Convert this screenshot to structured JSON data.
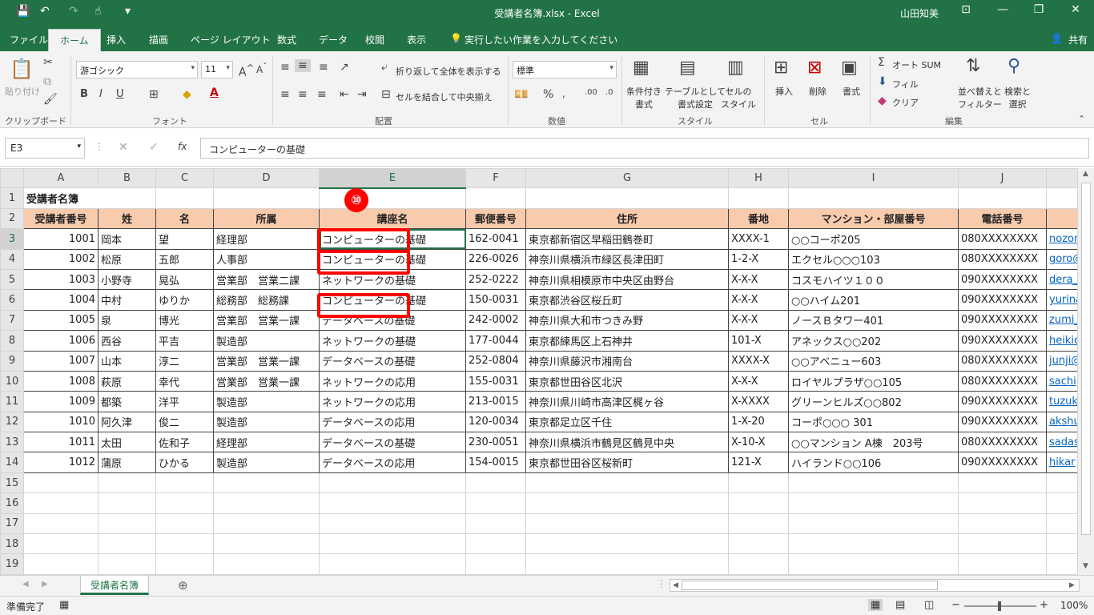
{
  "window": {
    "title": "受講者名簿.xlsx  -  Excel",
    "user": "山田知美"
  },
  "qat": {
    "save": "💾",
    "undo": "↶",
    "redo": "↷",
    "touch": "☝",
    "customize": "▾"
  },
  "ribbon_tabs": [
    "ファイル",
    "ホーム",
    "挿入",
    "描画",
    "ページ レイアウト",
    "数式",
    "データ",
    "校閲",
    "表示"
  ],
  "tell_me": "実行したい作業を入力してください",
  "share": "共有",
  "ribbon": {
    "clipboard": {
      "paste": "貼り付け",
      "group": "クリップボード"
    },
    "font": {
      "name": "游ゴシック",
      "size": "11",
      "group": "フォント",
      "bold": "B",
      "italic": "I",
      "underline": "U"
    },
    "alignment": {
      "wrap": "折り返して全体を表示する",
      "merge": "セルを結合して中央揃え",
      "group": "配置"
    },
    "number": {
      "format": "標準",
      "group": "数値",
      "percent": "%"
    },
    "styles": {
      "conditional": "条件付き\n書式",
      "table": "テーブルとして\n書式設定",
      "cell": "セルの\nスタイル",
      "group": "スタイル"
    },
    "cells": {
      "insert": "挿入",
      "delete": "削除",
      "format": "書式",
      "group": "セル"
    },
    "editing": {
      "autosum": "オート SUM",
      "fill": "フィル",
      "clear": "クリア",
      "sort": "並べ替えと\nフィルター",
      "find": "検索と\n選択",
      "group": "編集"
    }
  },
  "formula_bar": {
    "name_box": "E3",
    "fx": "fx",
    "content": "コンピューターの基礎"
  },
  "columns": [
    "A",
    "B",
    "C",
    "D",
    "E",
    "F",
    "G",
    "H",
    "I",
    "J"
  ],
  "sheet": {
    "title": "受講者名簿",
    "headers": [
      "受講者番号",
      "姓",
      "名",
      "所属",
      "講座名",
      "郵便番号",
      "住所",
      "番地",
      "マンション・部屋番号",
      "電話番号"
    ],
    "rows": [
      [
        "1001",
        "岡本",
        "望",
        "経理部",
        "コンピューターの基礎",
        "162-0041",
        "東京都新宿区早稲田鶴巻町",
        "XXXX-1",
        "○○コーポ205",
        "080XXXXXXXX",
        "nozomi"
      ],
      [
        "1002",
        "松原",
        "五郎",
        "人事部",
        "コンピューターの基礎",
        "226-0026",
        "神奈川県横浜市緑区長津田町",
        "1-2-X",
        "エクセル○○○103",
        "080XXXXXXXX",
        "goro@"
      ],
      [
        "1003",
        "小野寺",
        "晃弘",
        "営業部　営業二課",
        "ネットワークの基礎",
        "252-0222",
        "神奈川県相模原市中央区由野台",
        "X-X-X",
        "コスモハイツ１００",
        "090XXXXXXXX",
        "dera_"
      ],
      [
        "1004",
        "中村",
        "ゆりか",
        "総務部　総務課",
        "コンピューターの基礎",
        "150-0031",
        "東京都渋谷区桜丘町",
        "X-X-X",
        "○○ハイム201",
        "090XXXXXXXX",
        "yurina"
      ],
      [
        "1005",
        "泉",
        "博光",
        "営業部　営業一課",
        "データベースの基礎",
        "242-0002",
        "神奈川県大和市つきみ野",
        "X-X-X",
        "ノースＢタワー401",
        "090XXXXXXXX",
        "zumi_"
      ],
      [
        "1006",
        "西谷",
        "平吉",
        "製造部",
        "ネットワークの基礎",
        "177-0044",
        "東京都練馬区上石神井",
        "101-X",
        "アネックス○○202",
        "090XXXXXXXX",
        "heikic"
      ],
      [
        "1007",
        "山本",
        "淳二",
        "営業部　営業一課",
        "データベースの基礎",
        "252-0804",
        "神奈川県藤沢市湘南台",
        "XXXX-X",
        "○○アベニュー603",
        "080XXXXXXXX",
        "junji@"
      ],
      [
        "1008",
        "萩原",
        "幸代",
        "営業部　営業一課",
        "ネットワークの応用",
        "155-0031",
        "東京都世田谷区北沢",
        "X-X-X",
        "ロイヤルプラザ○○105",
        "080XXXXXXXX",
        "sachi"
      ],
      [
        "1009",
        "都築",
        "洋平",
        "製造部",
        "ネットワークの応用",
        "213-0015",
        "神奈川県川崎市高津区梶ヶ谷",
        "X-XXXX",
        "グリーンヒルズ○○802",
        "090XXXXXXXX",
        "tuzuk"
      ],
      [
        "1010",
        "阿久津",
        "俊二",
        "製造部",
        "データベースの応用",
        "120-0034",
        "東京都足立区千住",
        "1-X-20",
        "コーポ○○○ 301",
        "090XXXXXXXX",
        "akshu"
      ],
      [
        "1011",
        "太田",
        "佐和子",
        "経理部",
        "データベースの基礎",
        "230-0051",
        "神奈川県横浜市鶴見区鶴見中央",
        "X-10-X",
        "○○マンション A棟　203号",
        "080XXXXXXXX",
        "sadas"
      ],
      [
        "1012",
        "蒲原",
        "ひかる",
        "製造部",
        "データベースの応用",
        "154-0015",
        "東京都世田谷区桜新町",
        "121-X",
        "ハイランド○○106",
        "090XXXXXXXX",
        "hikar"
      ]
    ]
  },
  "step_badge": "⑩",
  "sheet_tab": "受講者名簿",
  "status": {
    "ready": "準備完了",
    "zoom": "100%"
  }
}
